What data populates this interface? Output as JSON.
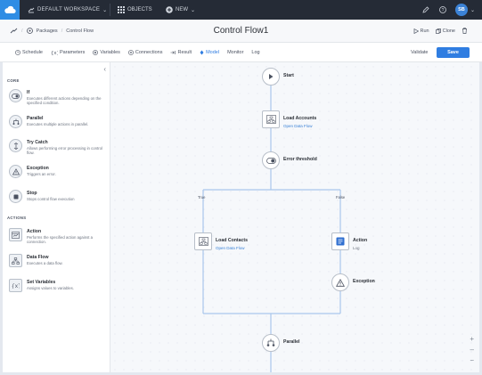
{
  "topbar": {
    "workspace": "DEFAULT WORKSPACE",
    "objects": "OBJECTS",
    "new": "NEW",
    "avatar": "SB"
  },
  "titlebar": {
    "breadcrumb": [
      "Packages",
      "Control Flow"
    ],
    "title": "Control Flow1",
    "run": "Run",
    "clone": "Clone"
  },
  "tabs": [
    {
      "label": "Schedule",
      "icon": "schedule-icon"
    },
    {
      "label": "Parameters",
      "icon": "parameters-icon"
    },
    {
      "label": "Variables",
      "icon": "variables-icon"
    },
    {
      "label": "Connections",
      "icon": "connections-icon"
    },
    {
      "label": "Result",
      "icon": "result-icon"
    },
    {
      "label": "Model",
      "icon": "model-icon"
    },
    {
      "label": "Monitor",
      "icon": ""
    },
    {
      "label": "Log",
      "icon": ""
    }
  ],
  "active_tab": "Model",
  "validate": "Validate",
  "save": "Save",
  "sidebar": {
    "core_title": "CORE",
    "actions_title": "ACTIONS",
    "core": [
      {
        "name": "If",
        "desc": "Executes different actions depending on the specified condition.",
        "icon": "toggle-icon"
      },
      {
        "name": "Parallel",
        "desc": "Executes multiple actions in parallel.",
        "icon": "parallel-icon"
      },
      {
        "name": "Try Catch",
        "desc": "Allows performing error processing in control flow.",
        "icon": "try-catch-icon"
      },
      {
        "name": "Exception",
        "desc": "Triggers an error.",
        "icon": "warning-icon"
      },
      {
        "name": "Stop",
        "desc": "Stops control flow execution",
        "icon": "stop-icon"
      }
    ],
    "actions": [
      {
        "name": "Action",
        "desc": "Performs the specified action against a connection.",
        "icon": "action-icon"
      },
      {
        "name": "Data Flow",
        "desc": "Executes a data flow.",
        "icon": "data-flow-icon"
      },
      {
        "name": "Set Variables",
        "desc": "Assigns values to variables.",
        "icon": "variables-icon"
      }
    ]
  },
  "canvas": {
    "start": "Start",
    "load_accounts": "Load Accounts",
    "load_accounts_link": "Open Data Flow",
    "error_threshold": "Error threshold",
    "true_label": "True",
    "false_label": "False",
    "load_contacts": "Load Contacts",
    "load_contacts_link": "Open Data Flow",
    "action": "Action",
    "action_sub": "Log",
    "exception": "Exception",
    "parallel": "Parallel"
  },
  "zoom": {
    "in": "+",
    "fit": "–",
    "out": "−"
  },
  "colors": {
    "accent": "#2f7de1",
    "topbar": "#252b36",
    "link": "#3b82d6"
  }
}
